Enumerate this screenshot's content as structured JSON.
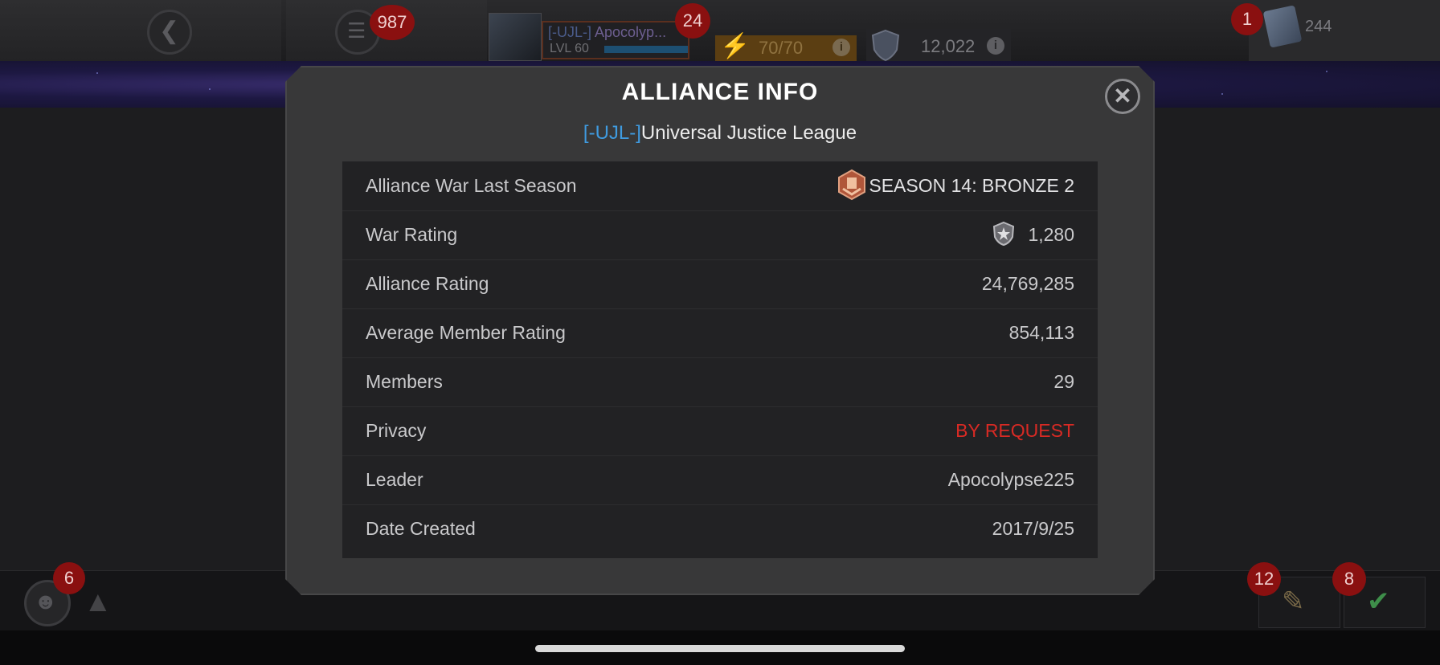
{
  "hud": {
    "menu_badge": "987",
    "profile_badge": "24",
    "alliance_tag": "[-UJL-]",
    "player_name": "Apocolyp...",
    "level": "LVL 60",
    "energy": "70/70",
    "war_rating_hud": "12,022",
    "units_badge": "1",
    "units_count": "244",
    "alliance_badge": "6",
    "quests_badge": "12",
    "done_badge": "8"
  },
  "modal": {
    "title": "ALLIANCE INFO",
    "alliance_tag": "[-UJL-]",
    "alliance_name": "Universal Justice League",
    "rows": [
      {
        "label": "Alliance War Last Season",
        "value": "SEASON 14: BRONZE 2"
      },
      {
        "label": "War Rating",
        "value": "1,280"
      },
      {
        "label": "Alliance Rating",
        "value": "24,769,285"
      },
      {
        "label": "Average Member Rating",
        "value": "854,113"
      },
      {
        "label": "Members",
        "value": "29"
      },
      {
        "label": "Privacy",
        "value": "BY REQUEST"
      },
      {
        "label": "Leader",
        "value": "Apocolypse225"
      },
      {
        "label": "Date Created",
        "value": "2017/9/25"
      }
    ]
  },
  "colors": {
    "tag_blue": "#3f9be0",
    "privacy_red": "#d82a24",
    "modal_bg": "#383839",
    "table_bg": "#222224"
  },
  "icons": {
    "close": "close-icon",
    "season": "bronze-season-icon",
    "war_rating": "war-rating-icon",
    "back": "back-arrow-icon",
    "menu": "menu-icon",
    "energy": "energy-bolt-icon"
  }
}
